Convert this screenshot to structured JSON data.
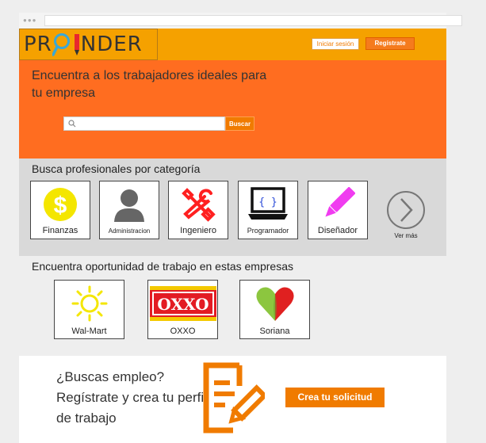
{
  "header": {
    "logo_text": "PROFINDER",
    "login_label": "Iniciar sesión",
    "signup_label": "Regístrate"
  },
  "hero": {
    "title": "Encuentra a los trabajadores ideales para tu empresa",
    "search_placeholder": "",
    "search_button": "Buscar"
  },
  "categories": {
    "title": "Busca profesionales por categoría",
    "items": [
      {
        "label": "Finanzas",
        "icon": "dollar-coin-icon",
        "color": "#f4e600"
      },
      {
        "label": "Administracion",
        "icon": "person-icon",
        "color": "#666666"
      },
      {
        "label": "Ingeniero",
        "icon": "tools-icon",
        "color": "#ff2020"
      },
      {
        "label": "Programador",
        "icon": "laptop-code-icon",
        "color": "#111111"
      },
      {
        "label": "Diseñador",
        "icon": "pencil-icon",
        "color": "#f03cf0"
      }
    ],
    "more_label": "Ver más"
  },
  "companies": {
    "title": "Encuentra oportunidad de trabajo en estas empresas",
    "items": [
      {
        "label": "Wal-Mart",
        "icon": "sun-icon",
        "color": "#f4e600"
      },
      {
        "label": "OXXO",
        "icon": "oxxo-logo",
        "logo_text": "OXXO",
        "color": "#e31b23"
      },
      {
        "label": "Soriana",
        "icon": "heart-icon",
        "color": "#e02020"
      }
    ]
  },
  "cta": {
    "text": "¿Buscas empleo? Regístrate y crea tu perfil de trabajo",
    "button": "Crea tu solicitud"
  },
  "colors": {
    "header": "#f5a100",
    "hero": "#ff6d20",
    "accent": "#f07b00"
  }
}
